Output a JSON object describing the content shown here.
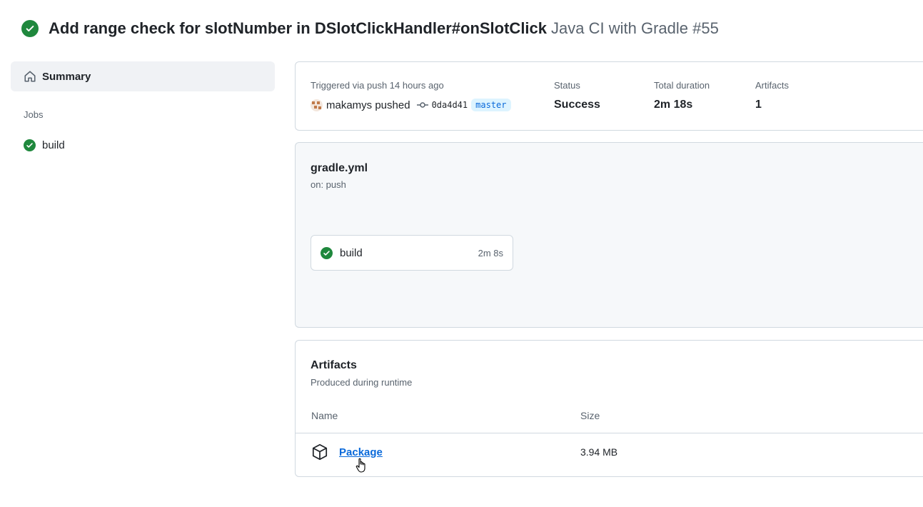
{
  "header": {
    "title": "Add range check for slotNumber in DSlotClickHandler#onSlotClick",
    "workflow_run": "Java CI with Gradle #55",
    "status_icon": "check-circle-fill-icon"
  },
  "sidebar": {
    "summary_label": "Summary",
    "jobs_heading": "Jobs",
    "jobs": [
      {
        "label": "build",
        "status": "success"
      }
    ]
  },
  "summary": {
    "trigger_text": "Triggered via push 14 hours ago",
    "actor": "makamys pushed",
    "commit": "0da4d41",
    "branch": "master",
    "status_label": "Status",
    "status_value": "Success",
    "duration_label": "Total duration",
    "duration_value": "2m 18s",
    "artifacts_label": "Artifacts",
    "artifacts_value": "1"
  },
  "workflow": {
    "file": "gradle.yml",
    "trigger": "on: push",
    "job": {
      "label": "build",
      "duration": "2m 8s"
    }
  },
  "artifacts": {
    "title": "Artifacts",
    "subtitle": "Produced during runtime",
    "col_name": "Name",
    "col_size": "Size",
    "rows": [
      {
        "name": "Package",
        "size": "3.94 MB"
      }
    ]
  },
  "colors": {
    "success": "#1f883d",
    "link": "#0969da",
    "muted": "#59636e",
    "border": "#d1d9e0"
  }
}
